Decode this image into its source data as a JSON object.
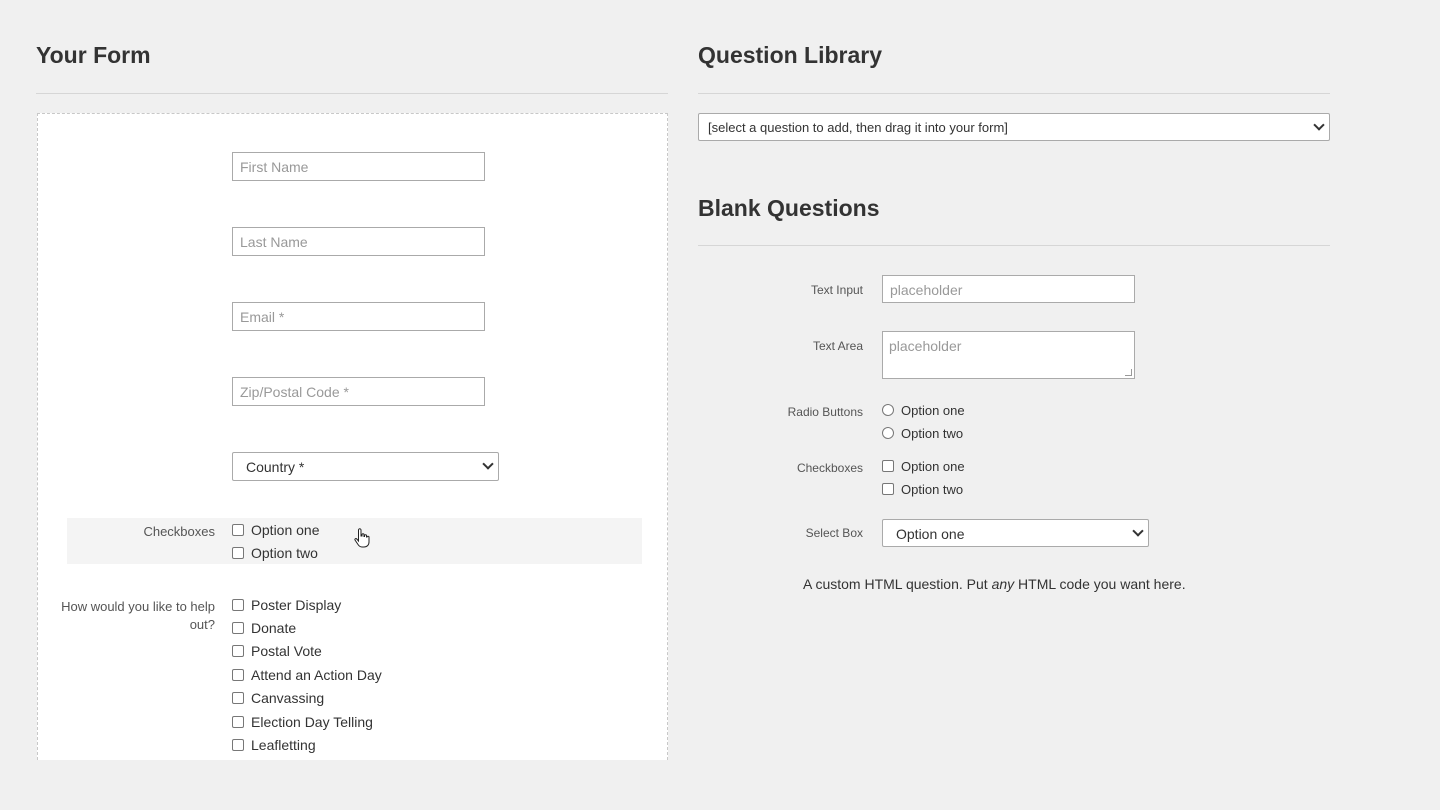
{
  "your_form": {
    "title": "Your Form",
    "fields": {
      "first_name": "First Name",
      "last_name": "Last Name",
      "email": "Email *",
      "zip": "Zip/Postal Code *",
      "country": "Country *"
    },
    "checkboxes": {
      "label": "Checkboxes",
      "options": [
        "Option one",
        "Option two"
      ]
    },
    "help": {
      "label": "How would you like to help out?",
      "options": [
        "Poster Display",
        "Donate",
        "Postal Vote",
        "Attend an Action Day",
        "Canvassing",
        "Election Day Telling",
        "Leafletting"
      ]
    }
  },
  "library": {
    "title": "Question Library",
    "select_value": "[select a question to add, then drag it into your form]"
  },
  "blank": {
    "title": "Blank Questions",
    "text_input": {
      "label": "Text Input",
      "placeholder": "placeholder"
    },
    "text_area": {
      "label": "Text Area",
      "placeholder": "placeholder"
    },
    "radio": {
      "label": "Radio Buttons",
      "options": [
        "Option one",
        "Option two"
      ]
    },
    "checkboxes": {
      "label": "Checkboxes",
      "options": [
        "Option one",
        "Option two"
      ]
    },
    "select": {
      "label": "Select Box",
      "value": "Option one"
    },
    "custom_html": {
      "before": "A custom HTML question. Put ",
      "emphasis": "any",
      "after": " HTML code you want here."
    }
  },
  "icons": {
    "chevron": "chevron-down-icon",
    "cursor": "hand-pointer-icon"
  }
}
